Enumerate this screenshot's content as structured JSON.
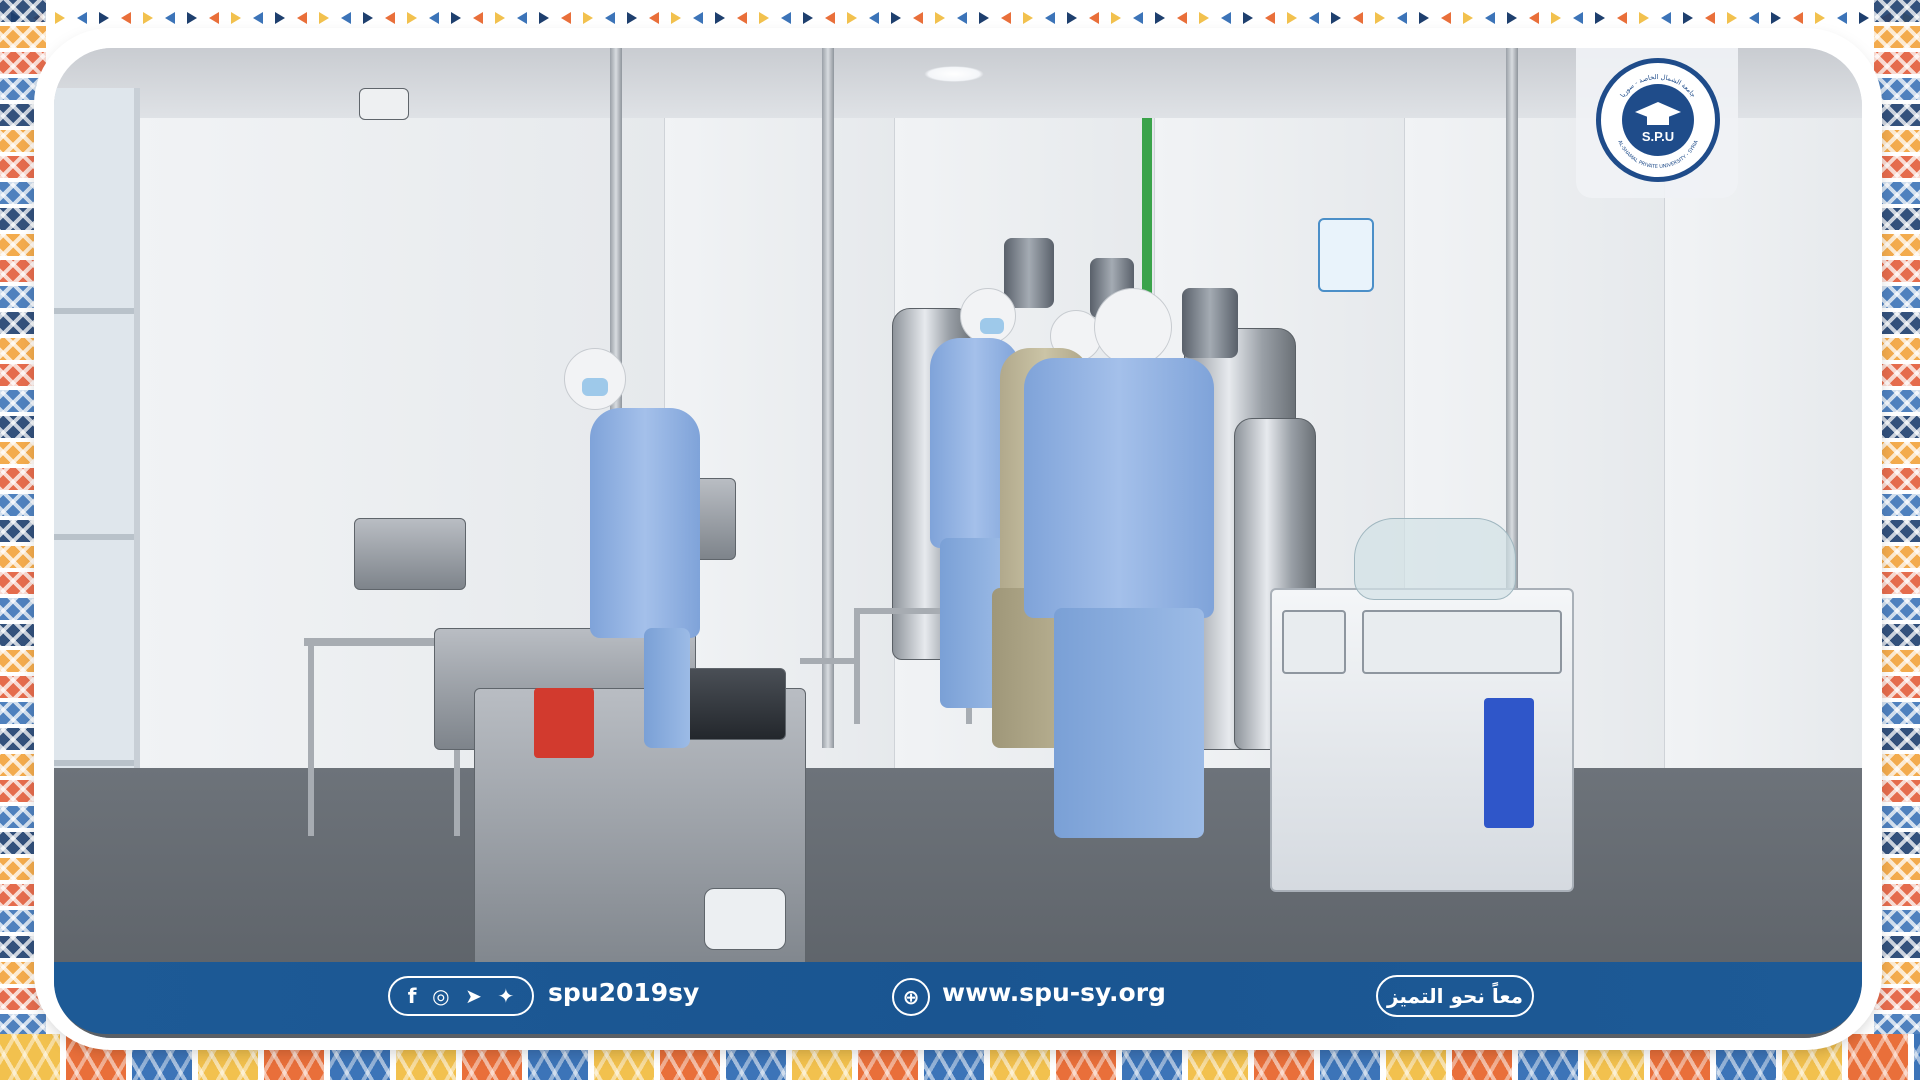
{
  "logo": {
    "abbr": "S.P.U",
    "arabic_name": "جامعة الشمال الخاصة - سوريا",
    "english_name": "AL-SHAMAL PRIVATE UNIVERSITY - SYRIA",
    "colors": {
      "primary": "#1f4c8a",
      "background": "#ffffff"
    }
  },
  "banner": {
    "social_icons": [
      "facebook-icon",
      "instagram-icon",
      "telegram-icon",
      "twitter-icon"
    ],
    "social_glyphs": {
      "facebook": "f",
      "instagram": "◎",
      "telegram": "➤",
      "twitter": "✦"
    },
    "handle": "spu2019sy",
    "website_icon": "globe-icon",
    "website_glyph": "⊕",
    "website": "www.spu-sy.org",
    "slogan": "معاً نحو التميز",
    "colors": {
      "background": "#1d5a96",
      "text": "#ffffff"
    }
  },
  "frame": {
    "colors": {
      "navy": "#1e3f6e",
      "orange": "#e96f3a",
      "yellow": "#f2c14e",
      "blue": "#3c74b8"
    }
  }
}
